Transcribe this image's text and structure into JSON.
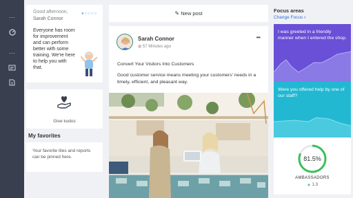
{
  "sidebar": {
    "items": [
      {
        "icon": "more-icon"
      },
      {
        "icon": "dashboard-icon"
      },
      {
        "icon": "more-icon"
      },
      {
        "icon": "people-icon"
      },
      {
        "icon": "document-icon"
      }
    ]
  },
  "greeting": {
    "line1": "Good afternoon,",
    "line2": "Sarah Connor",
    "message": "Everyone has room for improvement and can perform better with some training. We're here to help you with that."
  },
  "kudos": {
    "label": "Give kudos"
  },
  "favorites": {
    "title": "My favorites",
    "empty_text": "Your favorite tiles and reports can be pinned here."
  },
  "feed": {
    "new_post_label": "New post",
    "post": {
      "author": "Sarah Connor",
      "time": "57 Minutes ago",
      "title": "Convert Your Visitors Into Customers",
      "body": "Good customer service means meeting your customers' needs in a timely, efficient, and pleasant way."
    }
  },
  "focus": {
    "title": "Focus areas",
    "change_link": "Change Focus",
    "cards": [
      {
        "question": "I was greeted in a friendly manner when I entered the shop.",
        "color": "#6a4fd7"
      },
      {
        "question": "Were you offered help by one of our staff?",
        "color": "#22b8d2"
      }
    ],
    "ambassadors": {
      "percent_label": "81.5%",
      "percent": 81.5,
      "label": "AMBASSADORS",
      "delta": "1.3"
    }
  },
  "colors": {
    "rail": "#3a3f4f",
    "accent": "#2a6fd6",
    "ring": "#3bbf5c"
  }
}
